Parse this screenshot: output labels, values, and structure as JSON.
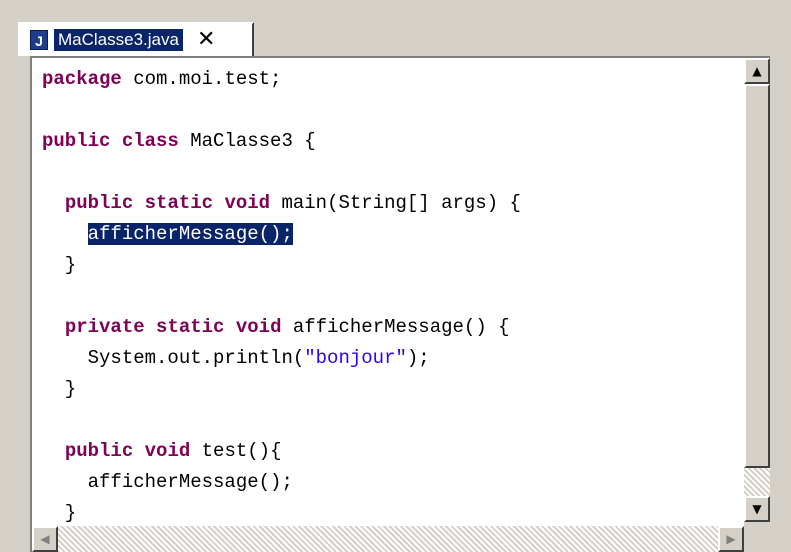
{
  "tab": {
    "icon": "java-file-icon",
    "icon_glyph": "J",
    "label": "MaClasse3.java",
    "close_glyph": "✕"
  },
  "code": {
    "lines": [
      {
        "parts": [
          {
            "t": "package",
            "k": "kw"
          },
          {
            "t": " com.moi.test;",
            "k": ""
          }
        ]
      },
      {
        "parts": []
      },
      {
        "parts": [
          {
            "t": "public",
            "k": "kw"
          },
          {
            "t": " ",
            "k": ""
          },
          {
            "t": "class",
            "k": "kw"
          },
          {
            "t": " MaClasse3 {",
            "k": ""
          }
        ]
      },
      {
        "parts": []
      },
      {
        "parts": [
          {
            "t": "  ",
            "k": ""
          },
          {
            "t": "public",
            "k": "kw"
          },
          {
            "t": " ",
            "k": ""
          },
          {
            "t": "static",
            "k": "kw"
          },
          {
            "t": " ",
            "k": ""
          },
          {
            "t": "void",
            "k": "kw"
          },
          {
            "t": " main(String[] args) {",
            "k": ""
          }
        ]
      },
      {
        "parts": [
          {
            "t": "    ",
            "k": ""
          },
          {
            "t": "afficherMessage();",
            "k": "sel"
          }
        ]
      },
      {
        "parts": [
          {
            "t": "  }",
            "k": ""
          }
        ]
      },
      {
        "parts": []
      },
      {
        "parts": [
          {
            "t": "  ",
            "k": ""
          },
          {
            "t": "private",
            "k": "kw"
          },
          {
            "t": " ",
            "k": ""
          },
          {
            "t": "static",
            "k": "kw"
          },
          {
            "t": " ",
            "k": ""
          },
          {
            "t": "void",
            "k": "kw"
          },
          {
            "t": " afficherMessage() {",
            "k": ""
          }
        ]
      },
      {
        "parts": [
          {
            "t": "    System.out.println(",
            "k": ""
          },
          {
            "t": "\"bonjour\"",
            "k": "str"
          },
          {
            "t": ");",
            "k": ""
          }
        ]
      },
      {
        "parts": [
          {
            "t": "  }",
            "k": ""
          }
        ]
      },
      {
        "parts": []
      },
      {
        "parts": [
          {
            "t": "  ",
            "k": ""
          },
          {
            "t": "public",
            "k": "kw"
          },
          {
            "t": " ",
            "k": ""
          },
          {
            "t": "void",
            "k": "kw"
          },
          {
            "t": " test(){",
            "k": ""
          }
        ]
      },
      {
        "parts": [
          {
            "t": "    afficherMessage();",
            "k": ""
          }
        ]
      },
      {
        "parts": [
          {
            "t": "  }",
            "k": ""
          }
        ]
      }
    ]
  },
  "scrollbars": {
    "up_glyph": "▲",
    "down_glyph": "▼",
    "left_glyph": "◀",
    "right_glyph": "▶"
  },
  "colors": {
    "keyword": "#7f0055",
    "string": "#2a00ff",
    "selection_bg": "#0a246a"
  }
}
